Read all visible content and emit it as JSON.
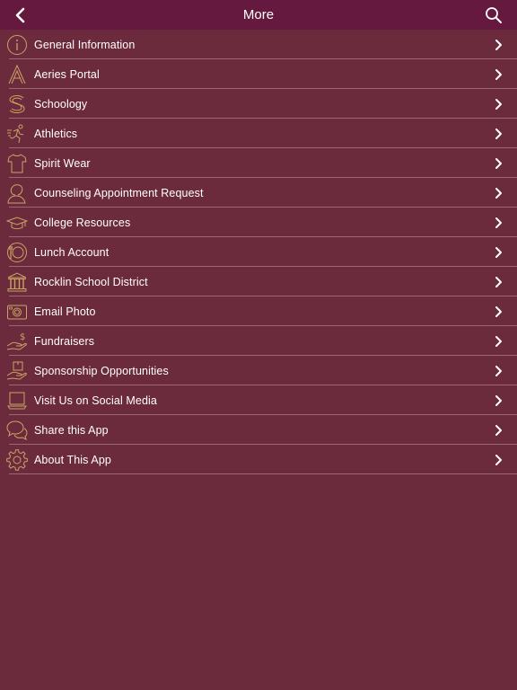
{
  "header": {
    "title": "More"
  },
  "colors": {
    "header_bg": "#66193f",
    "list_bg": "#6c2a3d",
    "icon_gold": "#c9a464",
    "text": "#ffffff"
  },
  "list": {
    "items": [
      {
        "label": "General Information",
        "icon": "info-icon"
      },
      {
        "label": "Aeries Portal",
        "icon": "letter-a-icon"
      },
      {
        "label": "Schoology",
        "icon": "letter-s-icon"
      },
      {
        "label": "Athletics",
        "icon": "runner-icon"
      },
      {
        "label": "Spirit Wear",
        "icon": "shirt-icon"
      },
      {
        "label": "Counseling Appointment Request",
        "icon": "person-icon"
      },
      {
        "label": "College Resources",
        "icon": "graduation-cap-icon"
      },
      {
        "label": "Lunch Account",
        "icon": "lunch-icon"
      },
      {
        "label": "Rocklin School District",
        "icon": "building-icon"
      },
      {
        "label": "Email Photo",
        "icon": "camera-icon"
      },
      {
        "label": "Fundraisers",
        "icon": "hand-money-icon"
      },
      {
        "label": "Sponsorship Opportunities",
        "icon": "hand-box-icon"
      },
      {
        "label": "Visit Us on Social Media",
        "icon": "laptop-icon"
      },
      {
        "label": "Share this App",
        "icon": "chat-bubbles-icon"
      },
      {
        "label": "About This App",
        "icon": "gear-icon"
      }
    ]
  }
}
